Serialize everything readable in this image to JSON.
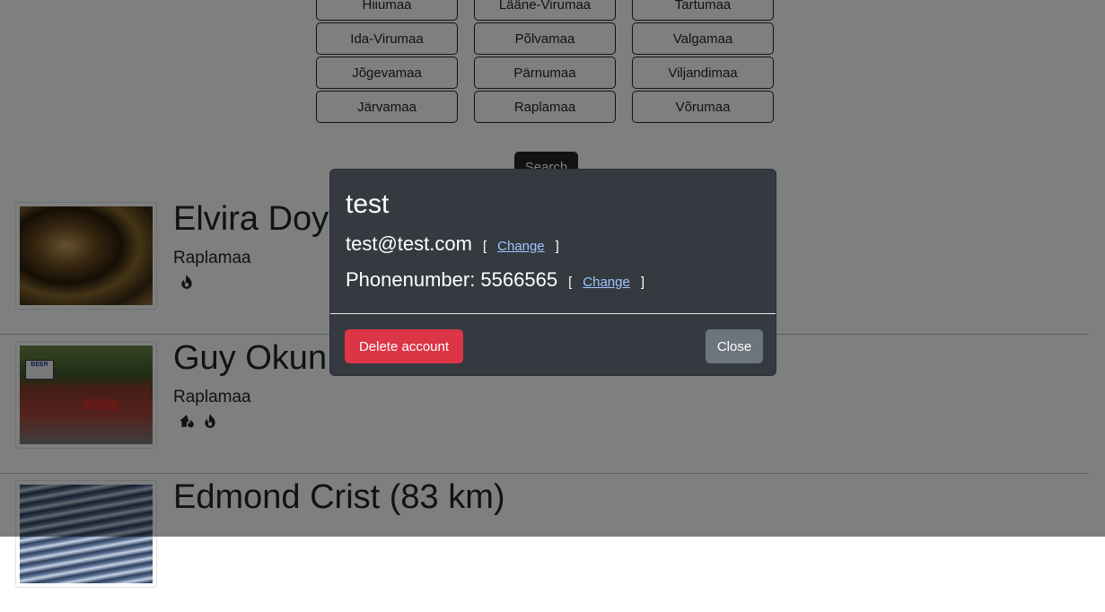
{
  "counties": [
    [
      "Hiiumaa",
      "Lääne-Virumaa",
      "Tartumaa"
    ],
    [
      "Ida-Virumaa",
      "Põlvamaa",
      "Valgamaa"
    ],
    [
      "Jõgevamaa",
      "Pärnumaa",
      "Viljandimaa"
    ],
    [
      "Järvamaa",
      "Raplamaa",
      "Võrumaa"
    ]
  ],
  "search_label": "Search",
  "results": [
    {
      "name": "Elvira Doy",
      "county": "Raplamaa",
      "icons": [
        "fire-icon"
      ]
    },
    {
      "name": "Guy Okun",
      "county": "Raplamaa",
      "icons": [
        "home-fire-icon",
        "fire-icon"
      ]
    },
    {
      "name": "Edmond Crist (83 km)",
      "county": "",
      "icons": []
    }
  ],
  "modal": {
    "title": "test",
    "email": "test@test.com",
    "phone": "Phonenumber: 5566565",
    "bracket_open": "[",
    "bracket_close": "]",
    "change_label": "Change",
    "delete_label": "Delete account",
    "close_label": "Close"
  },
  "colors": {
    "modal_bg": "#343a40",
    "danger": "#dc3545",
    "secondary": "#6c757d",
    "link": "#9ec5fe"
  }
}
